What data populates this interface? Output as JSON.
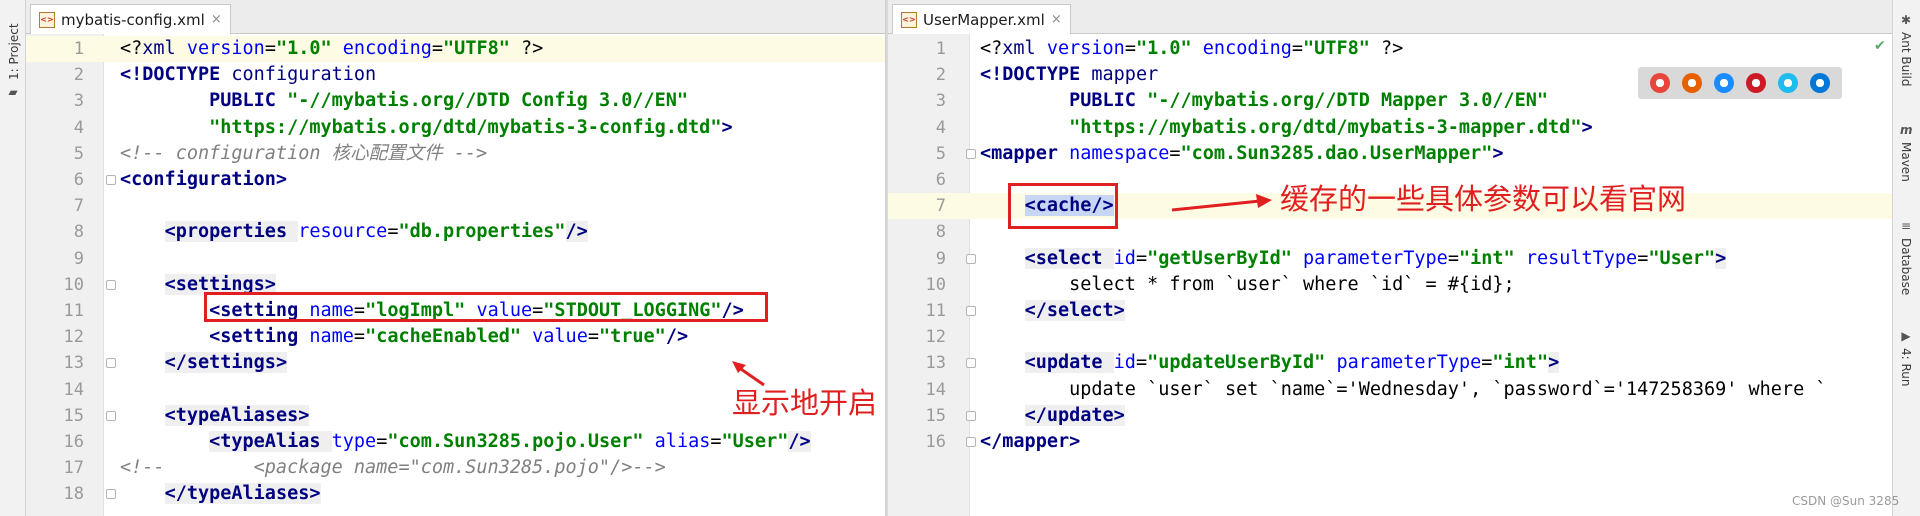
{
  "left_toolwindow": {
    "project_label": "1: Project"
  },
  "right_toolwindows": {
    "ant_build": "Ant Build",
    "maven": "Maven",
    "database": "Database",
    "run": "4: Run"
  },
  "left_editor": {
    "tab_title": "mybatis-config.xml",
    "close_symbol": "×",
    "lines": [
      {
        "n": "1",
        "parts": [
          {
            "c": "p",
            "t": "<?"
          },
          {
            "c": "t",
            "t": "xml "
          },
          {
            "c": "a",
            "t": "version"
          },
          {
            "c": "p",
            "t": "="
          },
          {
            "c": "v",
            "t": "\"1.0\""
          },
          {
            "c": "p",
            "t": " "
          },
          {
            "c": "a",
            "t": "encoding"
          },
          {
            "c": "p",
            "t": "="
          },
          {
            "c": "v",
            "t": "\"UTF8\""
          },
          {
            "c": "p",
            "t": " ?>"
          }
        ]
      },
      {
        "n": "2",
        "parts": [
          {
            "c": "dt",
            "t": "<!DOCTYPE "
          },
          {
            "c": "t",
            "t": "configuration"
          }
        ]
      },
      {
        "n": "3",
        "parts": [
          {
            "c": "p",
            "t": "        "
          },
          {
            "c": "tb",
            "t": "PUBLIC "
          },
          {
            "c": "v",
            "t": "\"-//mybatis.org//DTD Config 3.0//EN\""
          }
        ]
      },
      {
        "n": "4",
        "parts": [
          {
            "c": "p",
            "t": "        "
          },
          {
            "c": "v",
            "t": "\"https://mybatis.org/dtd/mybatis-3-config.dtd\""
          },
          {
            "c": "dt",
            "t": ">"
          }
        ]
      },
      {
        "n": "5",
        "parts": [
          {
            "c": "c",
            "t": "<!-- configuration 核心配置文件 -->"
          }
        ]
      },
      {
        "n": "6",
        "parts": [
          {
            "c": "tb",
            "t": "<configuration>"
          }
        ]
      },
      {
        "n": "7",
        "parts": []
      },
      {
        "n": "8",
        "parts": [
          {
            "c": "p",
            "t": "    "
          },
          {
            "c": "tb",
            "t": "<properties "
          },
          {
            "c": "a",
            "t": "resource"
          },
          {
            "c": "p",
            "t": "="
          },
          {
            "c": "v",
            "t": "\"db.properties\""
          },
          {
            "c": "tb",
            "t": "/>"
          }
        ]
      },
      {
        "n": "9",
        "parts": []
      },
      {
        "n": "10",
        "parts": [
          {
            "c": "p",
            "t": "    "
          },
          {
            "c": "tb",
            "t": "<settings>"
          }
        ]
      },
      {
        "n": "11",
        "parts": [
          {
            "c": "p",
            "t": "        "
          },
          {
            "c": "tb",
            "t": "<setting "
          },
          {
            "c": "a",
            "t": "name"
          },
          {
            "c": "p",
            "t": "="
          },
          {
            "c": "v",
            "t": "\"logImpl\""
          },
          {
            "c": "p",
            "t": " "
          },
          {
            "c": "a",
            "t": "value"
          },
          {
            "c": "p",
            "t": "="
          },
          {
            "c": "v",
            "t": "\"STDOUT_LOGGING\""
          },
          {
            "c": "tb",
            "t": "/>"
          }
        ]
      },
      {
        "n": "12",
        "parts": [
          {
            "c": "p",
            "t": "        "
          },
          {
            "c": "tb",
            "t": "<setting "
          },
          {
            "c": "a",
            "t": "name"
          },
          {
            "c": "p",
            "t": "="
          },
          {
            "c": "v",
            "t": "\"cacheEnabled\""
          },
          {
            "c": "p",
            "t": " "
          },
          {
            "c": "a",
            "t": "value"
          },
          {
            "c": "p",
            "t": "="
          },
          {
            "c": "v",
            "t": "\"true\""
          },
          {
            "c": "tb",
            "t": "/>"
          }
        ]
      },
      {
        "n": "13",
        "parts": [
          {
            "c": "p",
            "t": "    "
          },
          {
            "c": "tb",
            "t": "</settings>"
          }
        ]
      },
      {
        "n": "14",
        "parts": []
      },
      {
        "n": "15",
        "parts": [
          {
            "c": "p",
            "t": "    "
          },
          {
            "c": "tb",
            "t": "<typeAliases>"
          }
        ]
      },
      {
        "n": "16",
        "parts": [
          {
            "c": "p",
            "t": "        "
          },
          {
            "c": "tb",
            "t": "<typeAlias "
          },
          {
            "c": "a",
            "t": "type"
          },
          {
            "c": "p",
            "t": "="
          },
          {
            "c": "v",
            "t": "\"com.Sun3285.pojo.User\""
          },
          {
            "c": "p",
            "t": " "
          },
          {
            "c": "a",
            "t": "alias"
          },
          {
            "c": "p",
            "t": "="
          },
          {
            "c": "v",
            "t": "\"User\""
          },
          {
            "c": "tb",
            "t": "/>"
          }
        ]
      },
      {
        "n": "17",
        "parts": [
          {
            "c": "c",
            "t": "<!--        <package name=\"com.Sun3285.pojo\"/>-->"
          }
        ]
      },
      {
        "n": "18",
        "parts": [
          {
            "c": "p",
            "t": "    "
          },
          {
            "c": "tb",
            "t": "</typeAliases>"
          }
        ]
      }
    ],
    "annotation": "显示地开启"
  },
  "right_editor": {
    "tab_title": "UserMapper.xml",
    "close_symbol": "×",
    "lines": [
      {
        "n": "1",
        "parts": [
          {
            "c": "p",
            "t": "<?"
          },
          {
            "c": "t",
            "t": "xml "
          },
          {
            "c": "a",
            "t": "version"
          },
          {
            "c": "p",
            "t": "="
          },
          {
            "c": "v",
            "t": "\"1.0\""
          },
          {
            "c": "p",
            "t": " "
          },
          {
            "c": "a",
            "t": "encoding"
          },
          {
            "c": "p",
            "t": "="
          },
          {
            "c": "v",
            "t": "\"UTF8\""
          },
          {
            "c": "p",
            "t": " ?>"
          }
        ]
      },
      {
        "n": "2",
        "parts": [
          {
            "c": "dt",
            "t": "<!DOCTYPE "
          },
          {
            "c": "t",
            "t": "mapper"
          }
        ]
      },
      {
        "n": "3",
        "parts": [
          {
            "c": "p",
            "t": "        "
          },
          {
            "c": "tb",
            "t": "PUBLIC "
          },
          {
            "c": "v",
            "t": "\"-//mybatis.org//DTD Mapper 3.0//EN\""
          }
        ]
      },
      {
        "n": "4",
        "parts": [
          {
            "c": "p",
            "t": "        "
          },
          {
            "c": "v",
            "t": "\"https://mybatis.org/dtd/mybatis-3-mapper.dtd\""
          },
          {
            "c": "dt",
            "t": ">"
          }
        ]
      },
      {
        "n": "5",
        "parts": [
          {
            "c": "tb",
            "t": "<mapper "
          },
          {
            "c": "a",
            "t": "namespace"
          },
          {
            "c": "p",
            "t": "="
          },
          {
            "c": "v",
            "t": "\"com.Sun3285.dao.UserMapper\""
          },
          {
            "c": "tb",
            "t": ">"
          }
        ]
      },
      {
        "n": "6",
        "parts": []
      },
      {
        "n": "7",
        "parts": [
          {
            "c": "p",
            "t": "    "
          },
          {
            "c": "tb",
            "t": "<cache/>"
          }
        ]
      },
      {
        "n": "8",
        "parts": []
      },
      {
        "n": "9",
        "parts": [
          {
            "c": "p",
            "t": "    "
          },
          {
            "c": "tb",
            "t": "<select "
          },
          {
            "c": "a",
            "t": "id"
          },
          {
            "c": "p",
            "t": "="
          },
          {
            "c": "v",
            "t": "\"getUserById\""
          },
          {
            "c": "p",
            "t": " "
          },
          {
            "c": "a",
            "t": "parameterType"
          },
          {
            "c": "p",
            "t": "="
          },
          {
            "c": "v",
            "t": "\"int\""
          },
          {
            "c": "p",
            "t": " "
          },
          {
            "c": "a",
            "t": "resultType"
          },
          {
            "c": "p",
            "t": "="
          },
          {
            "c": "v",
            "t": "\"User\""
          },
          {
            "c": "tb",
            "t": ">"
          }
        ]
      },
      {
        "n": "10",
        "parts": [
          {
            "c": "p",
            "t": "        select * from `user` where `id` = #{id};"
          }
        ]
      },
      {
        "n": "11",
        "parts": [
          {
            "c": "p",
            "t": "    "
          },
          {
            "c": "tb",
            "t": "</select>"
          }
        ]
      },
      {
        "n": "12",
        "parts": []
      },
      {
        "n": "13",
        "parts": [
          {
            "c": "p",
            "t": "    "
          },
          {
            "c": "tb",
            "t": "<update "
          },
          {
            "c": "a",
            "t": "id"
          },
          {
            "c": "p",
            "t": "="
          },
          {
            "c": "v",
            "t": "\"updateUserById\""
          },
          {
            "c": "p",
            "t": " "
          },
          {
            "c": "a",
            "t": "parameterType"
          },
          {
            "c": "p",
            "t": "="
          },
          {
            "c": "v",
            "t": "\"int\""
          },
          {
            "c": "tb",
            "t": ">"
          }
        ]
      },
      {
        "n": "14",
        "parts": [
          {
            "c": "p",
            "t": "        update `user` set `name`='Wednesday', `password`='147258369' where `"
          }
        ]
      },
      {
        "n": "15",
        "parts": [
          {
            "c": "p",
            "t": "    "
          },
          {
            "c": "tb",
            "t": "</update>"
          }
        ]
      },
      {
        "n": "16",
        "parts": [
          {
            "c": "tb",
            "t": "</mapper>"
          }
        ]
      }
    ],
    "annotation": "缓存的一些具体参数可以看官网"
  },
  "browser_icons": [
    "chrome-icon",
    "firefox-icon",
    "safari-icon",
    "opera-icon",
    "internet-explorer-icon",
    "edge-icon"
  ],
  "browser_colors": [
    "#e8453c",
    "#e66000",
    "#1a8cff",
    "#cc1b24",
    "#1ebbee",
    "#0078d7"
  ],
  "watermark": "CSDN @Sun 3285"
}
